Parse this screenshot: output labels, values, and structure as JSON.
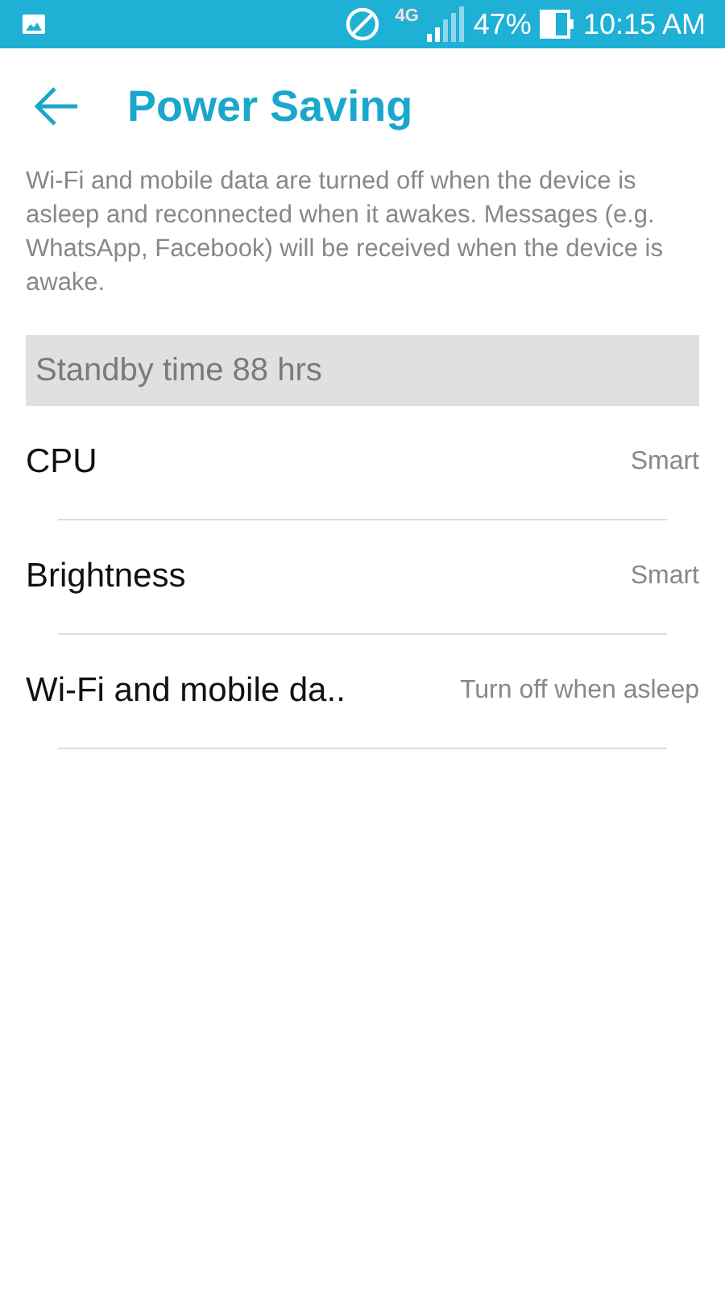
{
  "status_bar": {
    "network": "4G",
    "battery": "47%",
    "time": "10:15 AM"
  },
  "header": {
    "title": "Power Saving"
  },
  "description": "Wi-Fi and mobile data are turned off when the device is asleep and reconnected when it awakes. Messages (e.g. WhatsApp, Facebook) will be received when the device is awake.",
  "standby": "Standby time 88 hrs",
  "settings": [
    {
      "label": "CPU",
      "value": "Smart"
    },
    {
      "label": "Brightness",
      "value": "Smart"
    },
    {
      "label": "Wi-Fi and mobile da..",
      "value": "Turn off when asleep"
    }
  ]
}
